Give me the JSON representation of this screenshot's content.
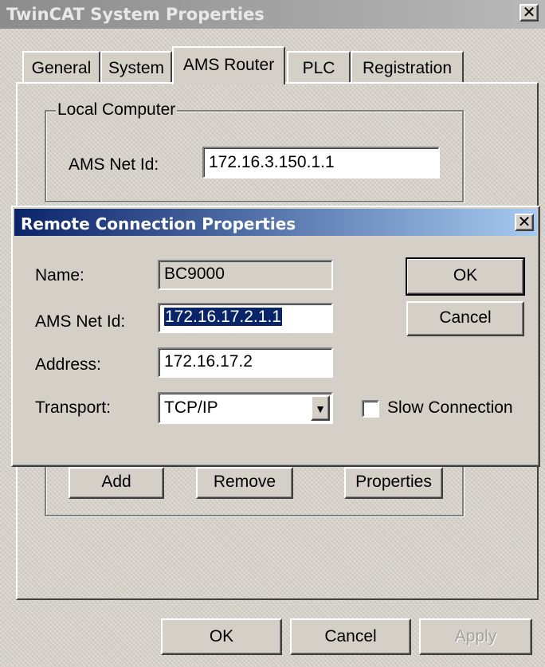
{
  "main_window": {
    "title": "TwinCAT System Properties",
    "close_glyph": "✕",
    "tabs": [
      {
        "label": "General"
      },
      {
        "label": "System"
      },
      {
        "label": "AMS Router"
      },
      {
        "label": "PLC"
      },
      {
        "label": "Registration"
      }
    ],
    "active_tab": "AMS Router",
    "local_computer": {
      "group_label": "Local Computer",
      "ams_net_id_label": "AMS Net Id:",
      "ams_net_id_value": "172.16.3.150.1.1"
    },
    "routes_buttons": {
      "add": "Add",
      "remove": "Remove",
      "properties": "Properties"
    },
    "footer_buttons": {
      "ok": "OK",
      "cancel": "Cancel",
      "apply": "Apply"
    }
  },
  "remote_dialog": {
    "title": "Remote Connection Properties",
    "close_glyph": "✕",
    "name_label": "Name:",
    "name_value": "BC9000",
    "ams_net_id_label": "AMS Net Id:",
    "ams_net_id_value": "172.16.17.2.1.1",
    "address_label": "Address:",
    "address_value": "172.16.17.2",
    "transport_label": "Transport:",
    "transport_value": "TCP/IP",
    "dropdown_glyph": "▼",
    "slow_connection_label": "Slow Connection",
    "slow_connection_checked": false,
    "ok_label": "OK",
    "cancel_label": "Cancel"
  }
}
